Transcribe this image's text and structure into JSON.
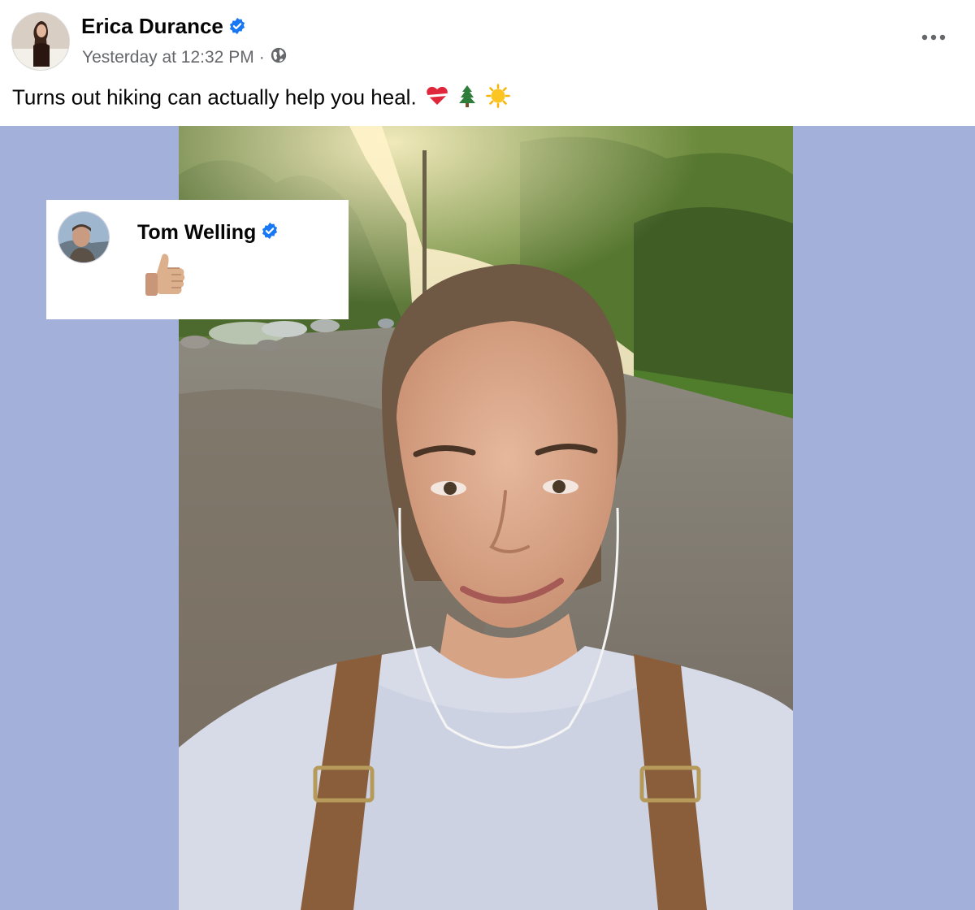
{
  "post": {
    "author": "Erica Durance",
    "timestamp": "Yesterday at 12:32 PM",
    "separator": "·",
    "audience_icon": "globe-icon",
    "caption": "Turns out hiking can actually help you heal.",
    "caption_emojis": [
      "mending-heart-emoji",
      "evergreen-tree-emoji",
      "sun-emoji"
    ],
    "more_icon": "more-options-icon",
    "verified_color": "#1877f2"
  },
  "media": {
    "background_color": "#a3b0da",
    "photo_description_icon": "selfie-photo"
  },
  "comment": {
    "author": "Tom Welling",
    "reaction": "thumbs-up-emoji"
  }
}
